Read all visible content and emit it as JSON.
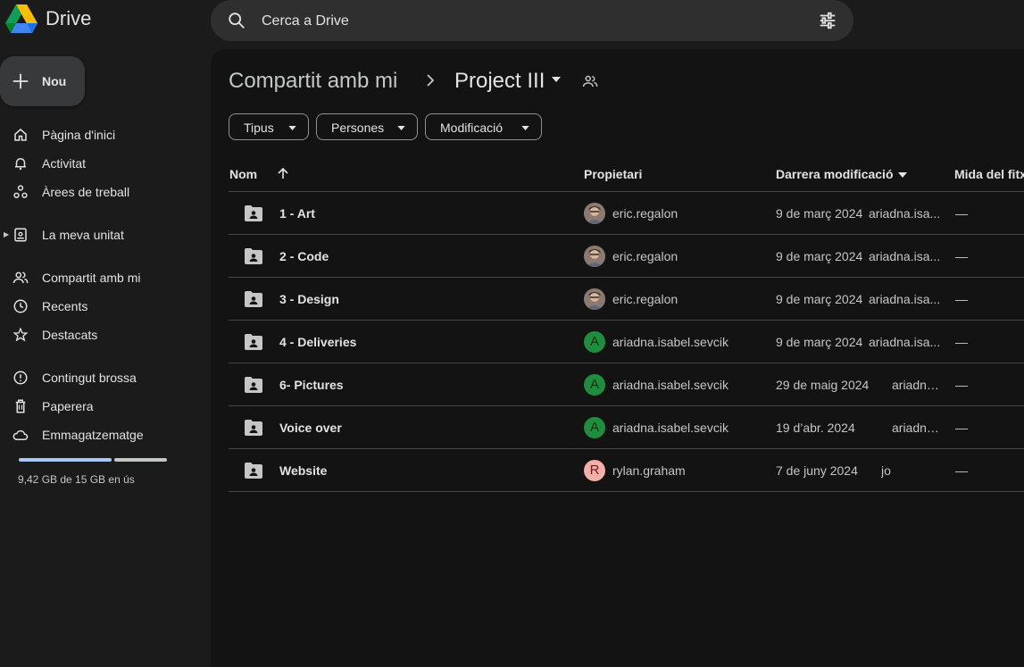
{
  "app": {
    "name": "Drive"
  },
  "search": {
    "placeholder": "Cerca a Drive",
    "icon": "search-icon",
    "filter_icon": "tune-icon"
  },
  "sidebar": {
    "new_label": "Nou",
    "items": [
      {
        "label": "Pàgina d'inici",
        "icon": "home-icon"
      },
      {
        "label": "Activitat",
        "icon": "bell-icon"
      },
      {
        "label": "Àrees de treball",
        "icon": "workspaces-icon"
      },
      {
        "label": "La meva unitat",
        "icon": "my-drive-icon"
      },
      {
        "label": "Compartit amb mi",
        "icon": "shared-icon"
      },
      {
        "label": "Recents",
        "icon": "clock-icon"
      },
      {
        "label": "Destacats",
        "icon": "star-icon"
      },
      {
        "label": "Contingut brossa",
        "icon": "spam-icon"
      },
      {
        "label": "Paperera",
        "icon": "trash-icon"
      },
      {
        "label": "Emmagatzematge",
        "icon": "cloud-icon"
      }
    ],
    "storage": {
      "text": "9,42 GB de 15 GB en ús",
      "used_fraction": 0.628
    }
  },
  "breadcrumb": {
    "parent": "Compartit amb mi",
    "current": "Project III"
  },
  "filters": [
    "Tipus",
    "Persones",
    "Modificació"
  ],
  "table": {
    "headers": {
      "name": "Nom",
      "owner": "Propietari",
      "modified": "Darrera modificació",
      "size": "Mida del fitx"
    },
    "rows": [
      {
        "name": "1 - Art",
        "owner": "eric.regalon",
        "avatar": "photo",
        "date": "9 de març 2024",
        "editor": "ariadna.isa...",
        "size": "—"
      },
      {
        "name": "2 - Code",
        "owner": "eric.regalon",
        "avatar": "photo",
        "date": "9 de març 2024",
        "editor": "ariadna.isa...",
        "size": "—"
      },
      {
        "name": "3 - Design",
        "owner": "eric.regalon",
        "avatar": "photo",
        "date": "9 de març 2024",
        "editor": "ariadna.isa...",
        "size": "—"
      },
      {
        "name": "4 - Deliveries",
        "owner": "ariadna.isabel.sevcik",
        "avatar": "A",
        "date": "9 de març 2024",
        "editor": "ariadna.isa...",
        "size": "—"
      },
      {
        "name": "6- Pictures",
        "owner": "ariadna.isabel.sevcik",
        "avatar": "A",
        "date": "29 de maig 2024",
        "editor": "ariadna.is...",
        "size": "—"
      },
      {
        "name": "Voice over",
        "owner": "ariadna.isabel.sevcik",
        "avatar": "A",
        "date": "19 d’abr. 2024",
        "editor": "ariadna.isab...",
        "size": "—"
      },
      {
        "name": "Website",
        "owner": "rylan.graham",
        "avatar": "R",
        "date": "7 de juny 2024",
        "editor": "jo",
        "size": "—"
      }
    ]
  },
  "colors": {
    "accent": "#a8c7fa",
    "avatar_a": "#1e8e3e",
    "avatar_r": "#f6aea9"
  }
}
